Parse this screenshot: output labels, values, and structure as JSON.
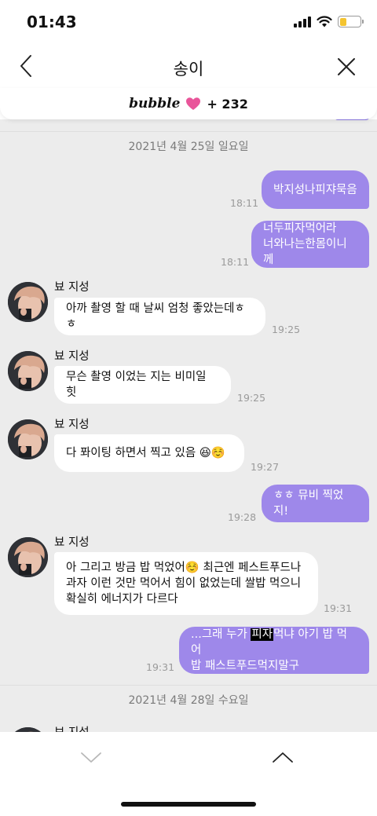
{
  "status_bar": {
    "time": "01:43",
    "battery_level": 0.35
  },
  "header": {
    "title": "송이",
    "back_icon": "chevron-left-icon",
    "close_icon": "close-icon"
  },
  "plan": {
    "logo": "bubble",
    "heart_icon": "heart-icon",
    "count": "+ 232"
  },
  "chat": {
    "date_1": "2021년 4월 25일 일요일",
    "date_2": "2021년 4월 28일 수요일",
    "messages": [
      {
        "direction": "out",
        "lines": [
          "박지성나피쟈묵음"
        ],
        "time": "18:11"
      },
      {
        "direction": "out",
        "lines": [
          "너두피자먹어라",
          "너와나는한몸이니께"
        ],
        "time": "18:11"
      },
      {
        "direction": "in",
        "sender": "뵤 지성",
        "lines": [
          "아까 촬영 할 때 날씨 엄청 좋았는데ㅎㅎ"
        ],
        "time": "19:25"
      },
      {
        "direction": "in",
        "sender": "뵤 지성",
        "lines": [
          "무슨 촬영 이었는 지는 비미일 힛"
        ],
        "time": "19:25"
      },
      {
        "direction": "in",
        "sender": "뵤 지성",
        "lines": [
          "다 퐈이팅 하면서 찍고 있음 😆☺️"
        ],
        "time": "19:27"
      },
      {
        "direction": "out",
        "lines": [
          "ㅎㅎ 뮤비 찍었지!"
        ],
        "time": "19:28"
      },
      {
        "direction": "in",
        "sender": "뵤 지성",
        "lines": [
          "아 그리고 방금 밥 먹었어☺️ 최근엔 페스트푸드나",
          "과자 이런 것만 먹어서 힘이 없었는데 쌀밥 먹으니",
          "확실히 에너지가 다르다"
        ],
        "time": "19:31"
      },
      {
        "direction": "out",
        "line1_pre": "...그래 누가 ",
        "line1_hl": "피자",
        "line1_post": "먹냐 아기 밥 먹어",
        "line2": "밥 패스트푸드먹지말구",
        "time": "19:31"
      }
    ],
    "next_sender": "뵤 지성"
  },
  "bottom_nav": {
    "down_icon": "chevron-down-icon",
    "up_icon": "chevron-up-icon"
  },
  "colors": {
    "out_bubble": "#9e88ea",
    "in_bubble": "#ffffff",
    "chat_bg": "#ececec",
    "heart": "#e9559a"
  }
}
